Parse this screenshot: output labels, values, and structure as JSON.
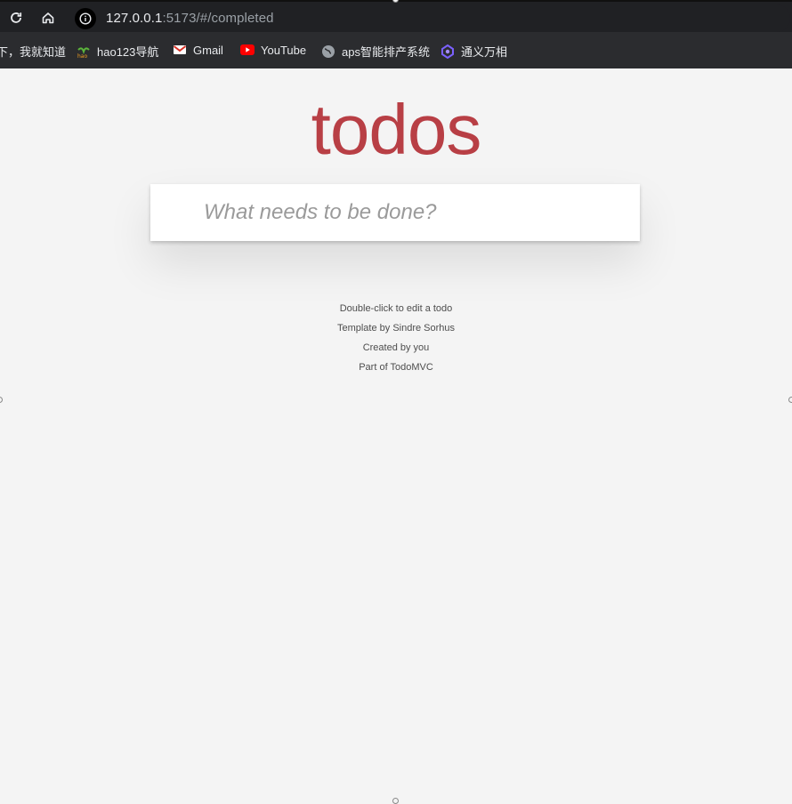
{
  "browser": {
    "url_host": "127.0.0.1",
    "url_rest": ":5173/#/completed",
    "bookmarks": [
      {
        "label": "下，我就知道",
        "icon": "paw-icon"
      },
      {
        "label": "hao123导航",
        "icon": "hao123-icon"
      },
      {
        "label": "Gmail",
        "icon": "gmail-icon"
      },
      {
        "label": "YouTube",
        "icon": "youtube-icon"
      },
      {
        "label": "aps智能排产系统",
        "icon": "globe-icon"
      },
      {
        "label": "通义万相",
        "icon": "tongyi-icon"
      }
    ]
  },
  "app": {
    "title": "todos",
    "new_todo_placeholder": "What needs to be done?",
    "info": {
      "edit_hint": "Double-click to edit a todo",
      "template": "Template by Sindre Sorhus",
      "created": "Created by you",
      "part_of": "Part of TodoMVC"
    }
  },
  "colors": {
    "title": "#b83f45",
    "page_bg": "#f4f4f4",
    "browser_bg": "#202124",
    "bookmarks_bg": "#2b2c2f"
  }
}
